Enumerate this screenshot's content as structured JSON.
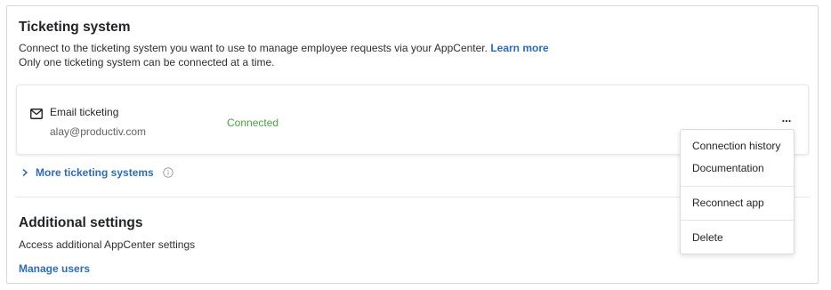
{
  "section": {
    "title": "Ticketing system",
    "description": "Connect to the ticketing system you want to use to manage employee requests via your AppCenter.",
    "learn_more": "Learn more",
    "note": "Only one ticketing system can be connected at a time."
  },
  "connection": {
    "name": "Email ticketing",
    "email": "alay@productiv.com",
    "status": "Connected",
    "status_color": "#4aa04a",
    "icon": "mail-icon",
    "menu_glyph": "..."
  },
  "more_systems": {
    "label": "More ticketing systems",
    "icon": "chevron-right-icon"
  },
  "additional": {
    "title": "Additional settings",
    "description": "Access additional AppCenter settings",
    "manage_link": "Manage users"
  },
  "menu": {
    "items": [
      "Connection history",
      "Documentation",
      "Reconnect app",
      "Delete"
    ]
  },
  "colors": {
    "link": "#2e6cb3",
    "border": "#d6d8db"
  }
}
